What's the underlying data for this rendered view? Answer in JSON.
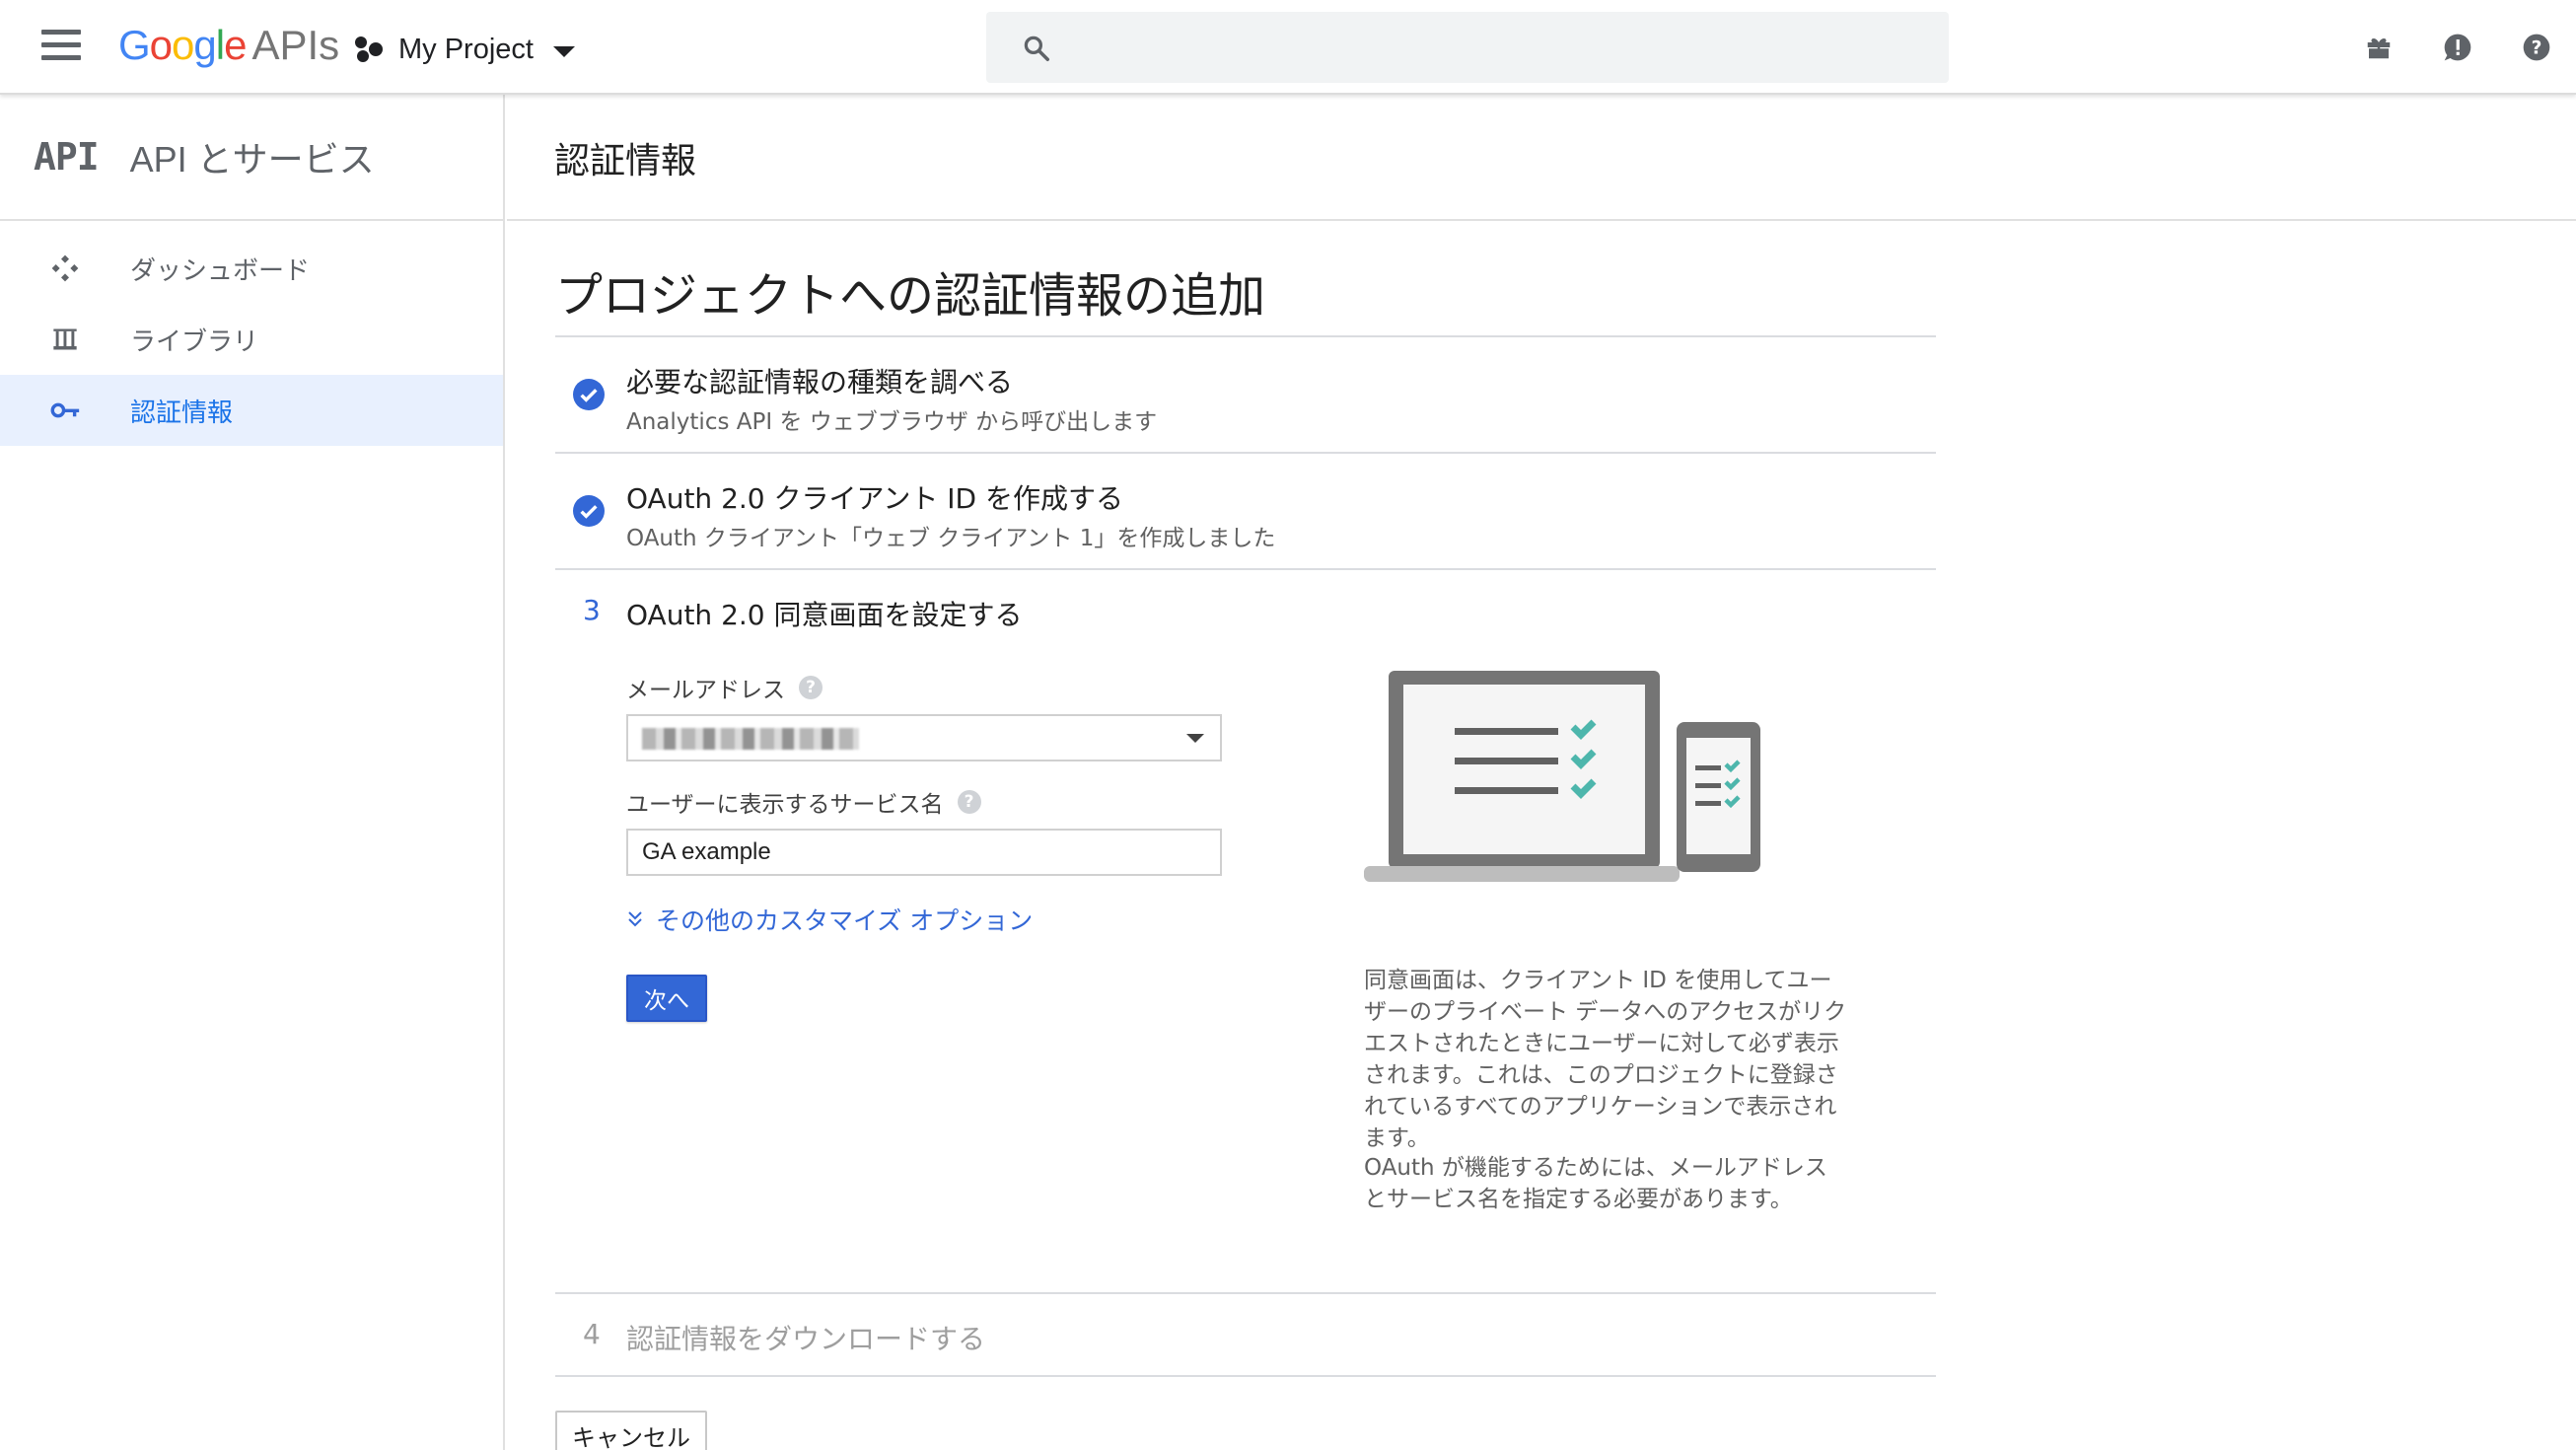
{
  "header": {
    "logo": {
      "g1": "G",
      "g2": "o",
      "g3": "o",
      "g4": "g",
      "g5": "l",
      "g6": "e",
      "apis": "APIs"
    },
    "project_name": "My Project",
    "icons": [
      "menu-icon",
      "search-icon",
      "gift-icon",
      "feedback-icon",
      "help-icon"
    ]
  },
  "sidebar": {
    "brand": "API",
    "title": "API とサービス",
    "items": [
      {
        "label": "ダッシュボード",
        "icon": "dashboard-icon",
        "active": false
      },
      {
        "label": "ライブラリ",
        "icon": "library-icon",
        "active": false
      },
      {
        "label": "認証情報",
        "icon": "key-icon",
        "active": true
      }
    ]
  },
  "main": {
    "header_title": "認証情報",
    "page_title": "プロジェクトへの認証情報の追加",
    "steps": [
      {
        "status": "done",
        "title": "必要な認証情報の種類を調べる",
        "subtitle": "Analytics API を ウェブブラウザ から呼び出します"
      },
      {
        "status": "done",
        "title": "OAuth 2.0 クライアント ID を作成する",
        "subtitle": "OAuth クライアント「ウェブ クライアント 1」を作成しました"
      },
      {
        "status": "active",
        "number": "3",
        "title": "OAuth 2.0 同意画面を設定する"
      },
      {
        "status": "pending",
        "number": "4",
        "title": "認証情報をダウンロードする"
      }
    ],
    "consent_form": {
      "email_label": "メールアドレス",
      "service_name_label": "ユーザーに表示するサービス名",
      "service_name_value": "GA example",
      "more_options": "その他のカスタマイズ オプション",
      "next_button": "次へ",
      "help_glyph": "?"
    },
    "description": {
      "p1": "同意画面は、クライアント ID を使用してユーザーのプライベート データへのアクセスがリクエストされたときにユーザーに対して必ず表示されます。これは、このプロジェクトに登録されているすべてのアプリケーションで表示されます。",
      "p2": "OAuth が機能するためには、メールアドレスとサービス名を指定する必要があります。"
    },
    "cancel_button": "キャンセル"
  },
  "colors": {
    "accent": "#3367d6",
    "check": "#3367d6",
    "illustration_check": "#4db6ac",
    "illustration_gray": "#757575",
    "active_nav_bg": "#e8f0fe"
  }
}
